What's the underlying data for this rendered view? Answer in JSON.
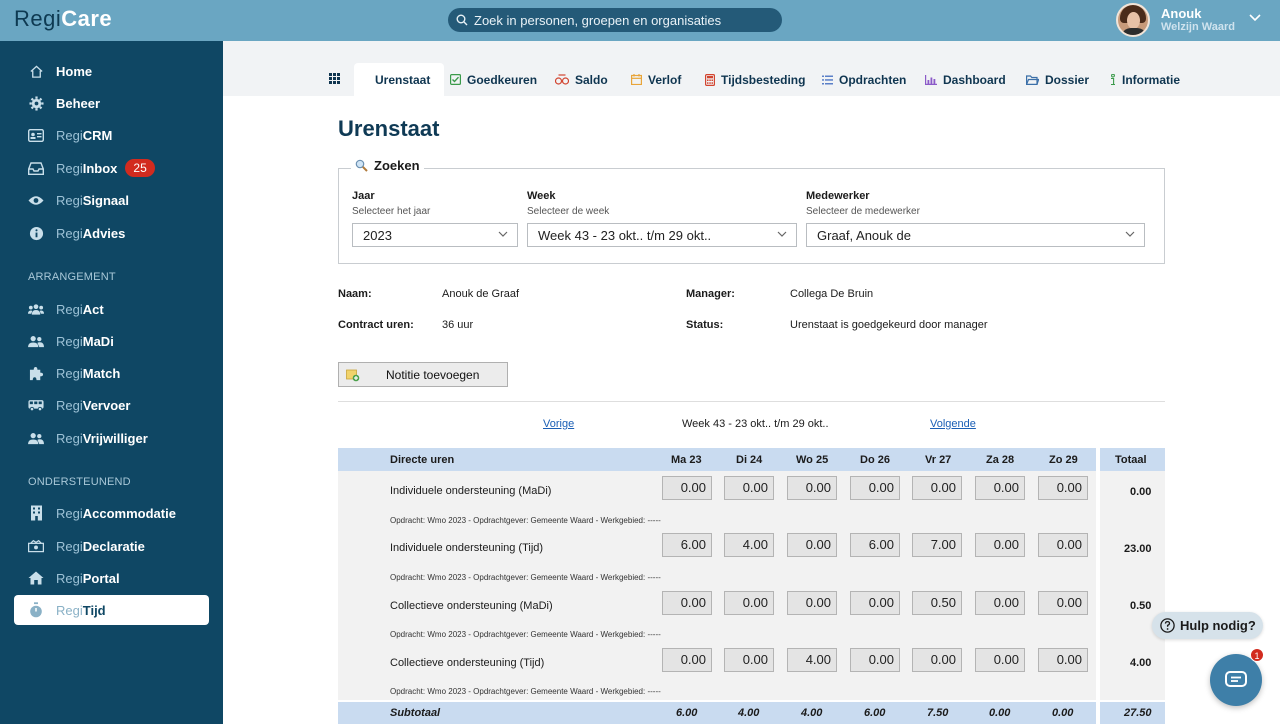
{
  "app": {
    "logo_prefix": "Regi",
    "logo_main": "Care"
  },
  "search": {
    "placeholder": "Zoek in personen, groepen en organisaties"
  },
  "user": {
    "name": "Anouk",
    "org": "Welzijn Waard"
  },
  "sidebar": {
    "items": [
      {
        "pre": "",
        "main": "Home",
        "icon": "home-icon"
      },
      {
        "pre": "",
        "main": "Beheer",
        "icon": "gear-icon"
      },
      {
        "pre": "Regi",
        "main": "CRM",
        "icon": "id-card-icon"
      },
      {
        "pre": "Regi",
        "main": "Inbox",
        "icon": "inbox-icon",
        "badge": "25"
      },
      {
        "pre": "Regi",
        "main": "Signaal",
        "icon": "eye-icon"
      },
      {
        "pre": "Regi",
        "main": "Advies",
        "icon": "info-icon"
      },
      {
        "pre": "Regi",
        "main": "Act",
        "icon": "users-icon"
      },
      {
        "pre": "Regi",
        "main": "MaDi",
        "icon": "user-group-icon"
      },
      {
        "pre": "Regi",
        "main": "Match",
        "icon": "puzzle-icon"
      },
      {
        "pre": "Regi",
        "main": "Vervoer",
        "icon": "bus-icon"
      },
      {
        "pre": "Regi",
        "main": "Vrijwilliger",
        "icon": "user-group-icon"
      },
      {
        "pre": "Regi",
        "main": "Accommodatie",
        "icon": "building-icon"
      },
      {
        "pre": "Regi",
        "main": "Declaratie",
        "icon": "money-icon"
      },
      {
        "pre": "Regi",
        "main": "Portal",
        "icon": "house-icon"
      },
      {
        "pre": "Regi",
        "main": "Tijd",
        "icon": "stopwatch-icon"
      }
    ],
    "sections": {
      "arrangement": "ARRANGEMENT",
      "ondersteunend": "ONDERSTEUNEND"
    }
  },
  "tabs": [
    {
      "label": "Urenstaat",
      "icon": "none"
    },
    {
      "label": "Goedkeuren",
      "icon": "check-square-icon"
    },
    {
      "label": "Saldo",
      "icon": "scale-icon"
    },
    {
      "label": "Verlof",
      "icon": "calendar-icon"
    },
    {
      "label": "Tijdsbesteding",
      "icon": "calculator-icon"
    },
    {
      "label": "Opdrachten",
      "icon": "list-icon"
    },
    {
      "label": "Dashboard",
      "icon": "chart-icon"
    },
    {
      "label": "Dossier",
      "icon": "folder-icon"
    },
    {
      "label": "Informatie",
      "icon": "info-icon"
    }
  ],
  "page": {
    "title": "Urenstaat"
  },
  "zoeken": {
    "legend": "Zoeken",
    "jaar": {
      "label": "Jaar",
      "hint": "Selecteer het jaar",
      "value": "2023"
    },
    "week": {
      "label": "Week",
      "hint": "Selecteer de week",
      "value": "Week 43 - 23 okt.. t/m 29 okt.."
    },
    "medewerker": {
      "label": "Medewerker",
      "hint": "Selecteer de medewerker",
      "value": "Graaf, Anouk de"
    }
  },
  "info": {
    "naam_label": "Naam:",
    "naam": "Anouk de Graaf",
    "contract_label": "Contract uren:",
    "contract": "36 uur",
    "manager_label": "Manager:",
    "manager": "Collega De Bruin",
    "status_label": "Status:",
    "status": "Urenstaat is goedgekeurd door manager"
  },
  "note_button": "Notitie toevoegen",
  "weeknav": {
    "prev": "Vorige",
    "current": "Week 43 - 23 okt.. t/m 29 okt..",
    "next": "Volgende"
  },
  "table": {
    "header": "Directe uren",
    "days": [
      "Ma 23",
      "Di 24",
      "Wo 25",
      "Do 26",
      "Vr 27",
      "Za 28",
      "Zo 29"
    ],
    "total_header": "Totaal",
    "rows": [
      {
        "label": "Individuele ondersteuning (MaDi)",
        "values": [
          "0.00",
          "0.00",
          "0.00",
          "0.00",
          "0.00",
          "0.00",
          "0.00"
        ],
        "total": "0.00",
        "sub": "Opdracht: Wmo 2023 - Opdrachtgever: Gemeente Waard - Werkgebied: -----"
      },
      {
        "label": "Individuele ondersteuning (Tijd)",
        "values": [
          "6.00",
          "4.00",
          "0.00",
          "6.00",
          "7.00",
          "0.00",
          "0.00"
        ],
        "total": "23.00",
        "sub": "Opdracht: Wmo 2023 - Opdrachtgever: Gemeente Waard - Werkgebied: -----"
      },
      {
        "label": "Collectieve ondersteuning (MaDi)",
        "values": [
          "0.00",
          "0.00",
          "0.00",
          "0.00",
          "0.50",
          "0.00",
          "0.00"
        ],
        "total": "0.50",
        "sub": "Opdracht: Wmo 2023 - Opdrachtgever: Gemeente Waard - Werkgebied: -----"
      },
      {
        "label": "Collectieve ondersteuning (Tijd)",
        "values": [
          "0.00",
          "0.00",
          "4.00",
          "0.00",
          "0.00",
          "0.00",
          "0.00"
        ],
        "total": "4.00",
        "sub": "Opdracht: Wmo 2023 - Opdrachtgever: Gemeente Waard - Werkgebied: -----"
      }
    ],
    "subtotal_label": "Subtotaal",
    "subtotals": [
      "6.00",
      "4.00",
      "4.00",
      "6.00",
      "7.50",
      "0.00",
      "0.00"
    ],
    "subtotal_total": "27.50"
  },
  "help": {
    "label": "Hulp nodig?",
    "chat_badge": "1"
  }
}
